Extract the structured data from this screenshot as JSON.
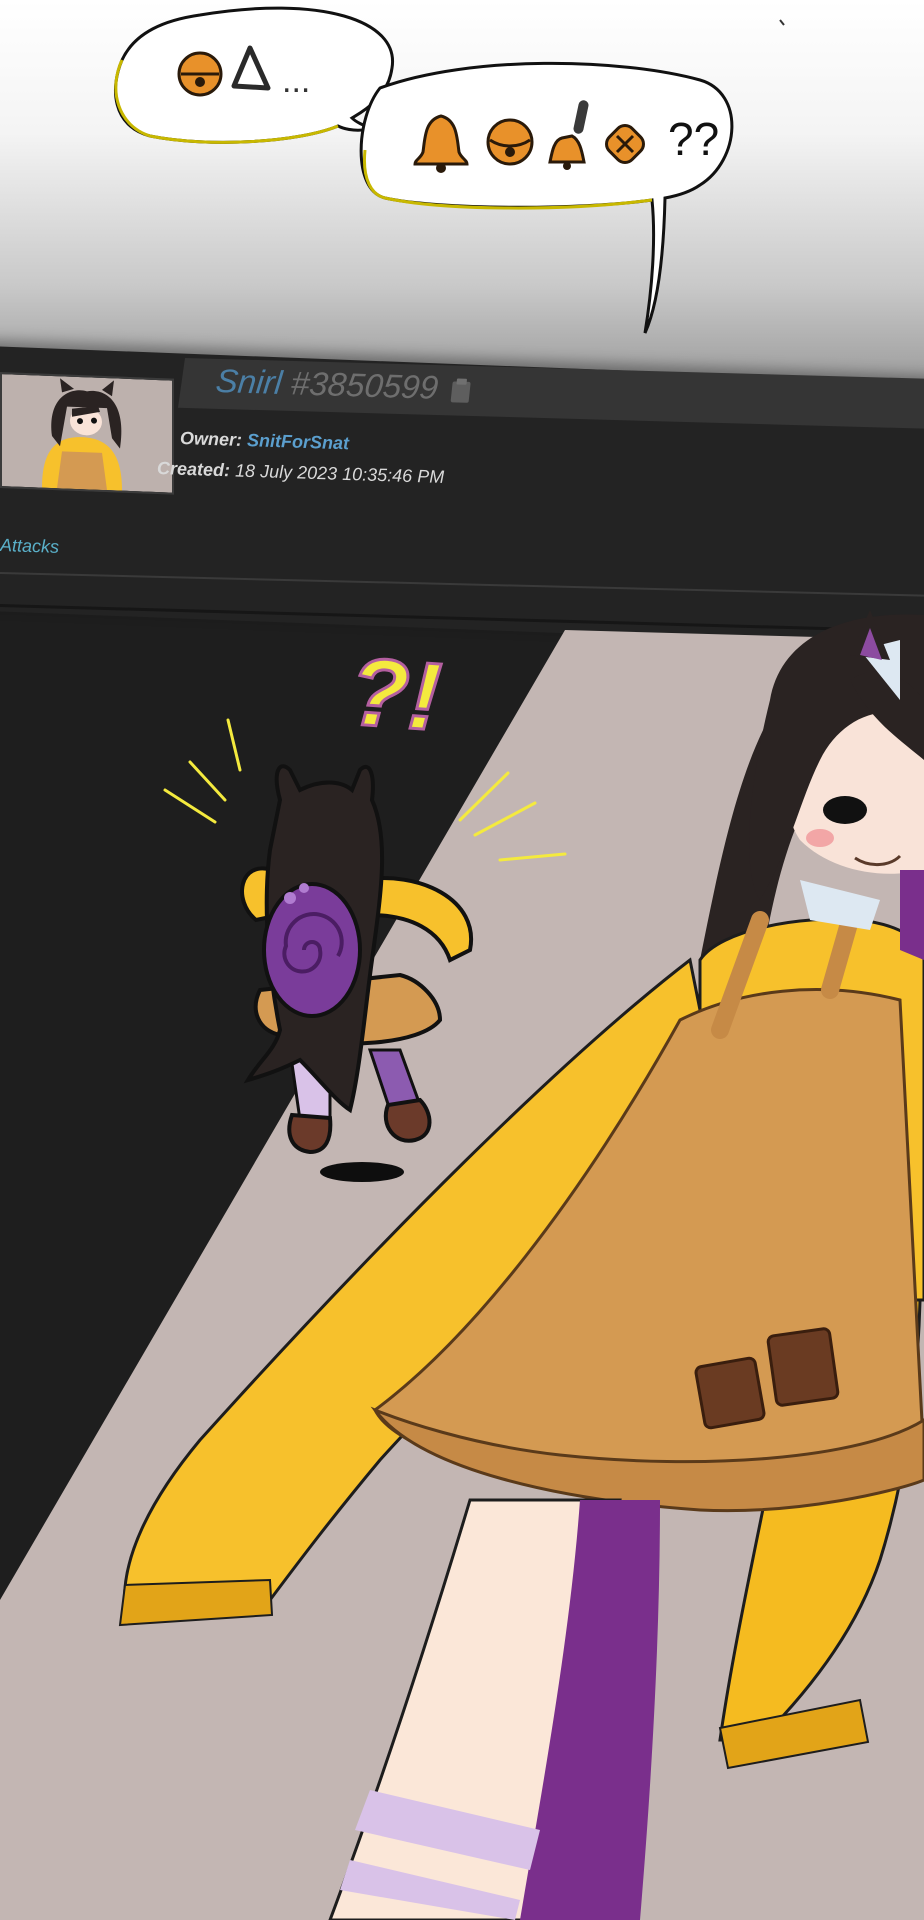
{
  "colors": {
    "panel_bg": "#232323",
    "artwork_bg": "#c3b6b3",
    "link": "#5b9fce",
    "name": "#4b7fa6",
    "sweater": "#f7c12c",
    "apron": "#d49a52",
    "hair": "#2a2322",
    "purple": "#7a2f8c",
    "exclaim": "#f4ea3e"
  },
  "speech": {
    "left_bubble": {
      "icons": [
        "bell-icon",
        "triangle-icon"
      ],
      "trail": "..."
    },
    "right_bubble": {
      "icons": [
        "bell-icon",
        "round-bell-icon",
        "hand-bell-icon",
        "jingle-bell-icon"
      ],
      "trail": "??"
    }
  },
  "profile": {
    "name": "Snirl",
    "id": "#3850599",
    "owner_label": "Owner:",
    "owner_value": "SnitForSnat",
    "created_label": "Created:",
    "created_value": "18 July 2023 10:35:46 PM",
    "copy_icon": "clipboard-icon"
  },
  "tabs": {
    "attacks": "Attacks"
  },
  "reaction": "?!"
}
